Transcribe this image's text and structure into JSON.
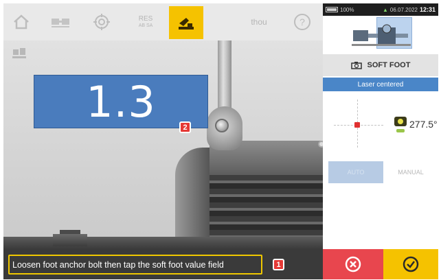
{
  "toolbar": {
    "items": [
      {
        "icon": "home-icon"
      },
      {
        "icon": "machine-icon"
      },
      {
        "icon": "target-icon"
      },
      {
        "label_top": "RES",
        "label_bottom": "AB SA",
        "icon": "results-icon"
      },
      {
        "icon": "soft-foot-icon",
        "active": true
      },
      {
        "label": "thou",
        "icon": "units-icon"
      },
      {
        "icon": "help-icon"
      }
    ],
    "sub_icon": "machine-view-icon"
  },
  "measurement": {
    "value": "1.3",
    "callout": "2"
  },
  "instruction": {
    "text": "Loosen foot anchor bolt then tap the soft foot value field",
    "callout": "1"
  },
  "panel": {
    "status": {
      "battery": "100%",
      "date": "06.07.2022",
      "time": "12:31"
    },
    "mode_label": "SOFT FOOT",
    "laser_status": "Laser centered",
    "sensor_angle": "277.5°",
    "tabs": {
      "auto": "AUTO",
      "manual": "MANUAL"
    }
  },
  "colors": {
    "accent": "#f5c200",
    "value_box": "#4a7cbd",
    "cancel": "#e8464e",
    "laser_bar": "#4a86c8"
  }
}
